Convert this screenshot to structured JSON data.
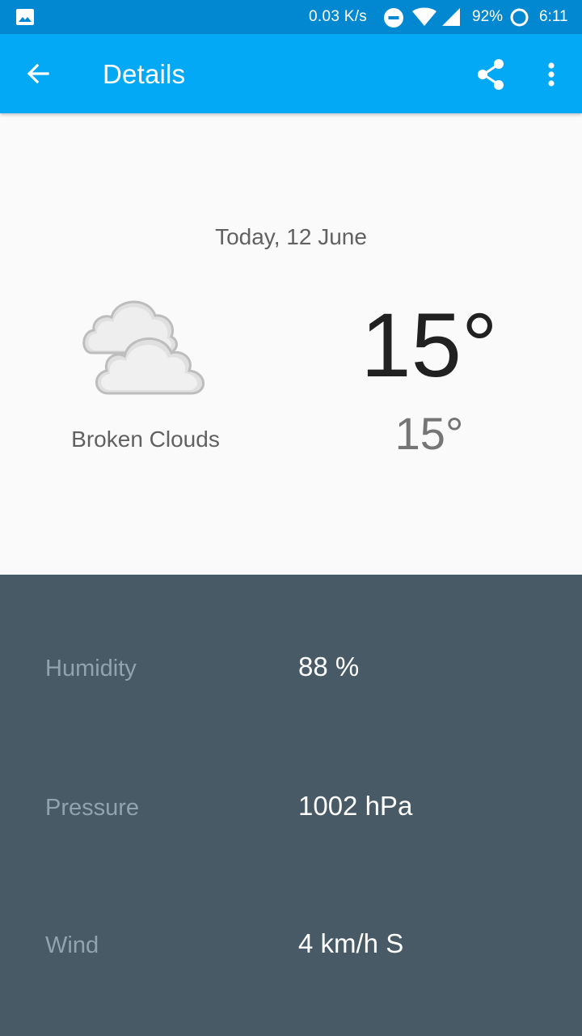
{
  "status_bar": {
    "net_speed": "0.03 K/s",
    "battery": "92%",
    "time": "6:11",
    "icons": [
      "gallery-icon",
      "do-not-disturb-icon",
      "wifi-icon",
      "cell-signal-icon",
      "battery-ring-icon"
    ]
  },
  "app_bar": {
    "title": "Details",
    "back_icon": "arrow-back-icon",
    "share_icon": "share-icon",
    "more_icon": "more-vert-icon",
    "color": "#03a9f4"
  },
  "forecast": {
    "date": "Today, 12 June",
    "condition": "Broken Clouds",
    "condition_icon": "broken-clouds-icon",
    "high": "15°",
    "low": "15°"
  },
  "details": {
    "background": "#475a66",
    "rows": [
      {
        "label": "Humidity",
        "value": "88 %"
      },
      {
        "label": "Pressure",
        "value": "1002 hPa"
      },
      {
        "label": "Wind",
        "value": "4 km/h S"
      }
    ]
  }
}
